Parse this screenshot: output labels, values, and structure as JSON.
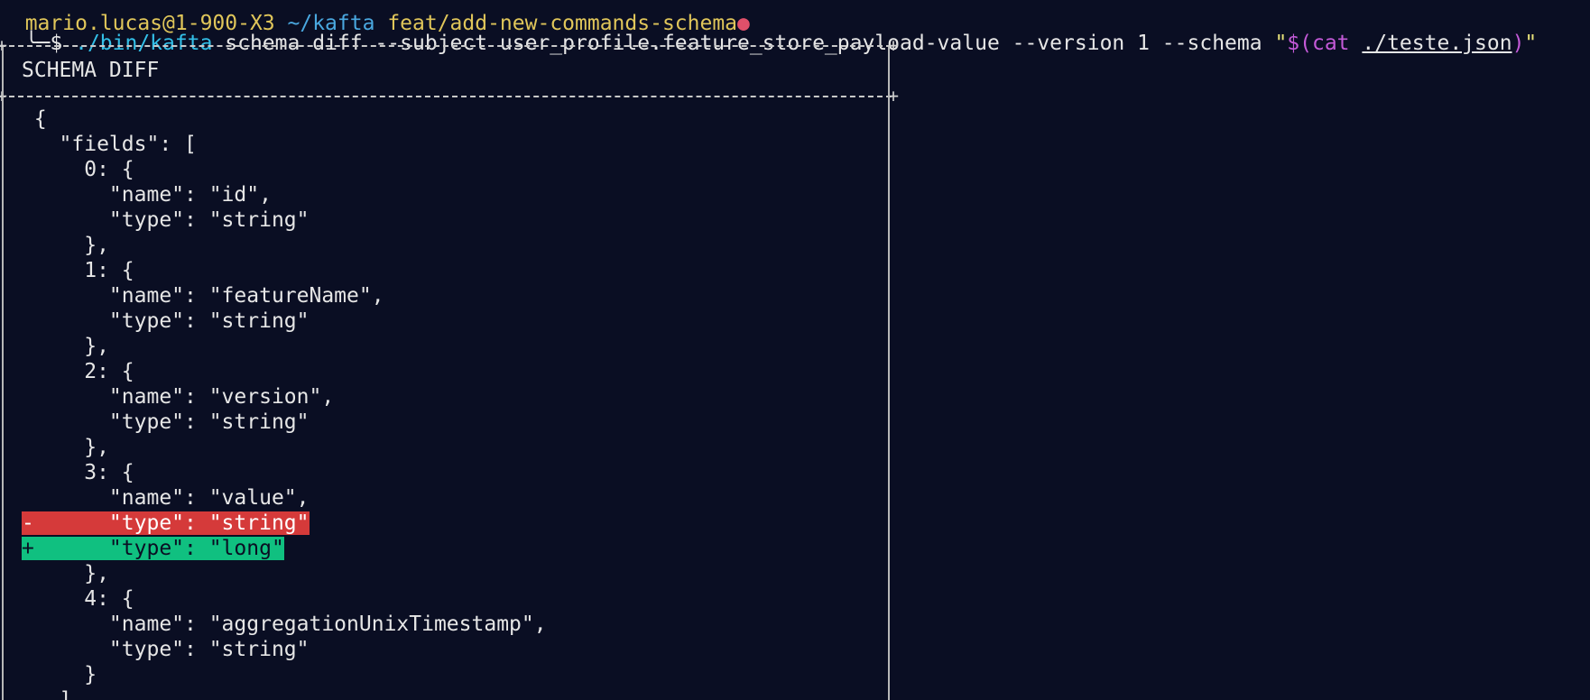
{
  "prompt": {
    "user": "mario.lucas@1-900-X3",
    "path": "~/kafta",
    "branch": "feat/add-new-commands-schema",
    "dirty_marker": "●"
  },
  "command": {
    "symbol": "╰─$ ",
    "binary": "./bin/kafta",
    "args": " schema diff --subject user_profile.feature_store_payload-value --version 1 --schema ",
    "quote_open": "\"",
    "subst_open": "$(cat ",
    "file": "./teste.json",
    "subst_close": ")",
    "quote_close": "\""
  },
  "diff": {
    "header": "SCHEMA DIFF",
    "lines": [
      {
        "text": "{",
        "type": "context"
      },
      {
        "text": "  \"fields\": [",
        "type": "context"
      },
      {
        "text": "    0: {",
        "type": "context"
      },
      {
        "text": "      \"name\": \"id\",",
        "type": "context"
      },
      {
        "text": "      \"type\": \"string\"",
        "type": "context"
      },
      {
        "text": "    },",
        "type": "context"
      },
      {
        "text": "    1: {",
        "type": "context"
      },
      {
        "text": "      \"name\": \"featureName\",",
        "type": "context"
      },
      {
        "text": "      \"type\": \"string\"",
        "type": "context"
      },
      {
        "text": "    },",
        "type": "context"
      },
      {
        "text": "    2: {",
        "type": "context"
      },
      {
        "text": "      \"name\": \"version\",",
        "type": "context"
      },
      {
        "text": "      \"type\": \"string\"",
        "type": "context"
      },
      {
        "text": "    },",
        "type": "context"
      },
      {
        "text": "    3: {",
        "type": "context"
      },
      {
        "text": "      \"name\": \"value\",",
        "type": "context"
      },
      {
        "text": "-      \"type\": \"string\"",
        "type": "removed"
      },
      {
        "text": "+      \"type\": \"long\"",
        "type": "added"
      },
      {
        "text": "    },",
        "type": "context"
      },
      {
        "text": "    4: {",
        "type": "context"
      },
      {
        "text": "      \"name\": \"aggregationUnixTimestamp\",",
        "type": "context"
      },
      {
        "text": "      \"type\": \"string\"",
        "type": "context"
      },
      {
        "text": "    }",
        "type": "context"
      },
      {
        "text": "  ]",
        "type": "context"
      }
    ]
  },
  "colors": {
    "background": "#0a0e23",
    "removed_bg": "#d53a3a",
    "added_bg": "#10c080",
    "binary": "#33c0e8",
    "subst": "#c45ad8",
    "prompt_user": "#e0c65a",
    "prompt_path": "#4aa8e0"
  }
}
